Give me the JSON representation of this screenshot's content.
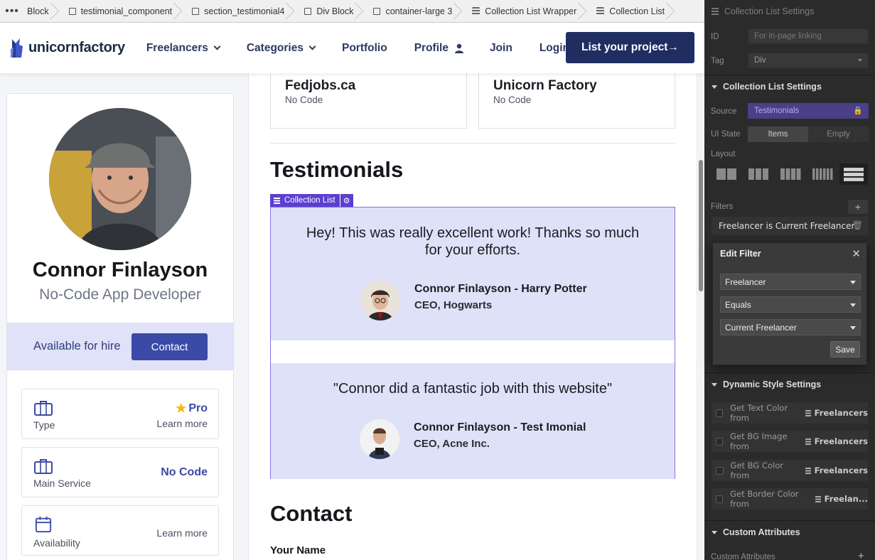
{
  "breadcrumbs": {
    "more": "•••",
    "items": [
      {
        "label": "Block",
        "icon": "none"
      },
      {
        "label": "testimonial_component",
        "icon": "box-icon"
      },
      {
        "label": "section_testimonial4",
        "icon": "box-icon"
      },
      {
        "label": "Div Block",
        "icon": "box-icon"
      },
      {
        "label": "container-large 3",
        "icon": "box-icon"
      },
      {
        "label": "Collection List Wrapper",
        "icon": "collection-icon"
      },
      {
        "label": "Collection List",
        "icon": "collection-icon"
      }
    ]
  },
  "header": {
    "logo_text": "unicornfactory",
    "nav": [
      {
        "label": "Freelancers",
        "dropdown": true
      },
      {
        "label": "Categories",
        "dropdown": true
      },
      {
        "label": "Portfolio",
        "dropdown": false
      },
      {
        "label": "Profile",
        "dropdown": false
      },
      {
        "label": "Join",
        "dropdown": false
      },
      {
        "label": "Login",
        "dropdown": false
      }
    ],
    "cta": "List your project→"
  },
  "profile": {
    "name": "Connor Finlayson",
    "role": "No-Code App Developer",
    "availability": "Available for hire",
    "contact_label": "Contact",
    "cards": [
      {
        "label": "Type",
        "value": "Pro",
        "more": "Learn more",
        "icon": "briefcase-icon"
      },
      {
        "label": "Main Service",
        "value": "No Code",
        "more": "",
        "icon": "briefcase-icon"
      },
      {
        "label": "Availability",
        "value": "",
        "more": "Learn more",
        "icon": "calendar-icon"
      }
    ]
  },
  "portfolio": [
    {
      "title": "Fedjobs.ca",
      "sub": "No Code"
    },
    {
      "title": "Unicorn Factory",
      "sub": "No Code"
    }
  ],
  "testimonials_section": {
    "title": "Testimonials",
    "collection_tag": "Collection List",
    "items": [
      {
        "quote": "Hey! This was really excellent work! Thanks so much for your efforts.",
        "name": "Connor Finlayson - Harry Potter",
        "company": "CEO, Hogwarts"
      },
      {
        "quote": "\"Connor did a fantastic job with this website\"",
        "name": "Connor Finlayson - Test Imonial",
        "company": "CEO, Acne Inc."
      }
    ]
  },
  "contact_section": {
    "title": "Contact",
    "field_label": "Your Name"
  },
  "panel": {
    "top_title": "Collection List Settings",
    "id_label": "ID",
    "id_placeholder": "For in-page linking",
    "tag_label": "Tag",
    "tag_value": "Div",
    "section_title": "Collection List Settings",
    "source_label": "Source",
    "source_value": "Testimonials",
    "ui_state_label": "UI State",
    "ui_state_items": "Items",
    "ui_state_empty": "Empty",
    "layout_label": "Layout",
    "filters_label": "Filters",
    "filter_pill": "Freelancer is Current Freelancer",
    "edit_filter": {
      "title": "Edit Filter",
      "field": "Freelancer",
      "operator": "Equals",
      "value": "Current Freelancer",
      "save": "Save"
    },
    "dynamic_title": "Dynamic Style Settings",
    "dynamic_rows": [
      {
        "label": "Get Text Color from",
        "source": "Freelancers"
      },
      {
        "label": "Get BG Image from",
        "source": "Freelancers"
      },
      {
        "label": "Get BG Color from",
        "source": "Freelancers"
      },
      {
        "label": "Get Border Color from",
        "source": "Freelan..."
      }
    ],
    "custom_attr_title": "Custom Attributes",
    "custom_attr_label": "Custom Attributes"
  },
  "colors": {
    "brand_navy": "#1f2d61",
    "accent_blue": "#3a4aa6",
    "testimonial_bg": "#dfe1f8",
    "selection_purple": "#5a3fd0",
    "panel_bg": "#2b2b2b"
  }
}
